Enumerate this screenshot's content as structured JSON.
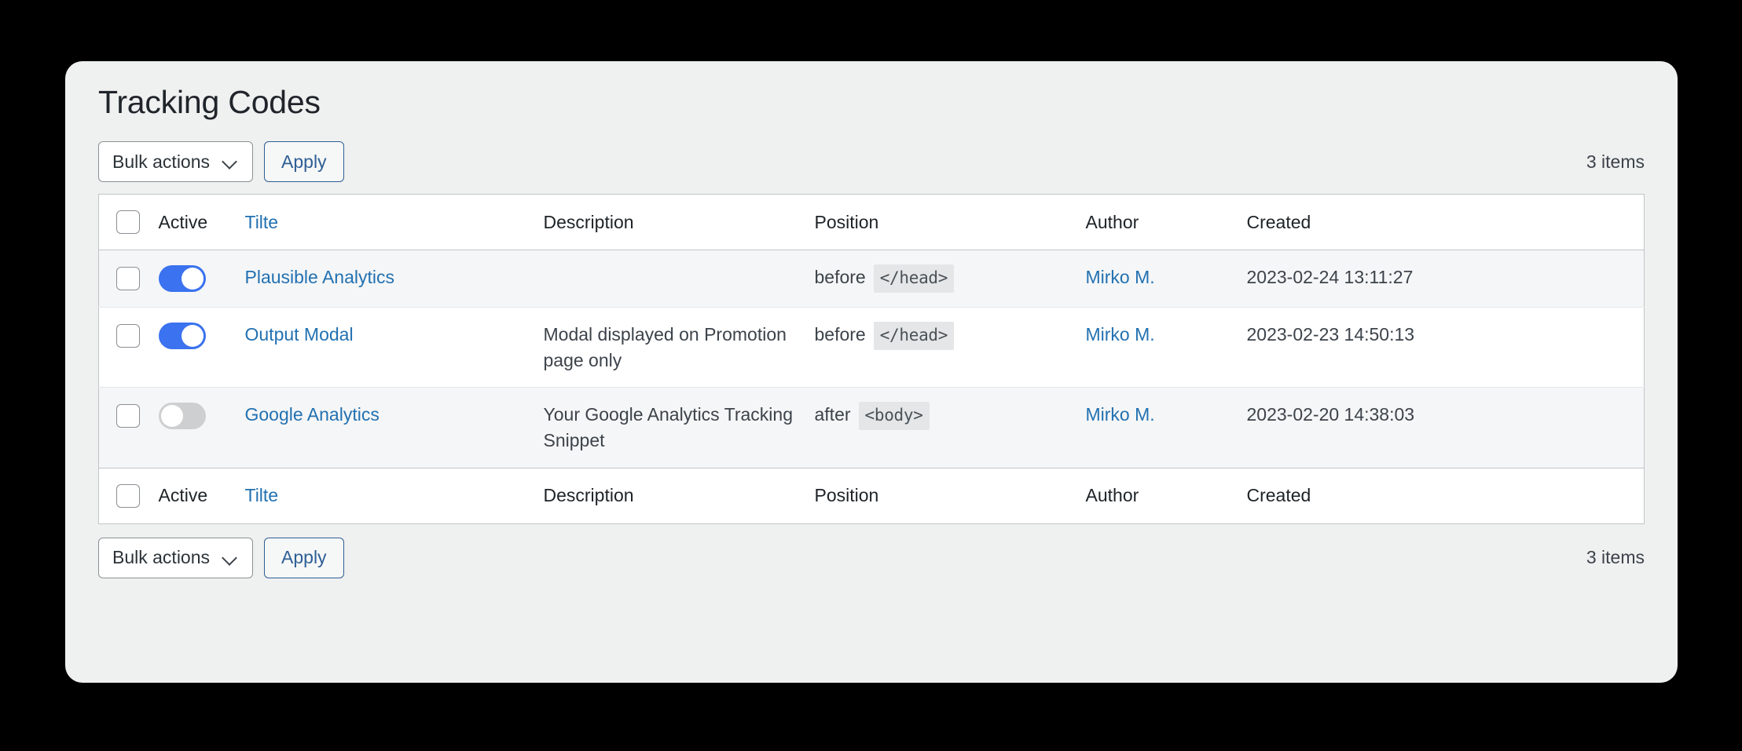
{
  "page": {
    "title": "Tracking Codes"
  },
  "toolbar_top": {
    "bulk_actions_label": "Bulk actions",
    "apply_label": "Apply",
    "items_count": "3 items"
  },
  "toolbar_bottom": {
    "bulk_actions_label": "Bulk actions",
    "apply_label": "Apply",
    "items_count": "3 items"
  },
  "table": {
    "columns": [
      {
        "key": "cb",
        "label": ""
      },
      {
        "key": "active",
        "label": "Active"
      },
      {
        "key": "title",
        "label": "Tilte",
        "is_link": true
      },
      {
        "key": "description",
        "label": "Description"
      },
      {
        "key": "position",
        "label": "Position"
      },
      {
        "key": "author",
        "label": "Author"
      },
      {
        "key": "created",
        "label": "Created"
      }
    ],
    "rows": [
      {
        "active": true,
        "title": "Plausible Analytics",
        "description": "",
        "position_word": "before",
        "position_code": "</head>",
        "author": "Mirko M.",
        "created": "2023-02-24 13:11:27"
      },
      {
        "active": true,
        "title": "Output Modal",
        "description": "Modal displayed on Promotion page only",
        "position_word": "before",
        "position_code": "</head>",
        "author": "Mirko M.",
        "created": "2023-02-23 14:50:13"
      },
      {
        "active": false,
        "title": "Google Analytics",
        "description": "Your Google Analytics Tracking Snippet",
        "position_word": "after",
        "position_code": "<body>",
        "author": "Mirko M.",
        "created": "2023-02-20 14:38:03"
      }
    ]
  },
  "colors": {
    "link": "#2271b1",
    "toggle_on": "#3a72ef",
    "toggle_off": "#cdcfd1",
    "card_bg": "#eff0f0",
    "row_alt_bg": "#f5f6f7",
    "button_border": "#2e5f95"
  }
}
